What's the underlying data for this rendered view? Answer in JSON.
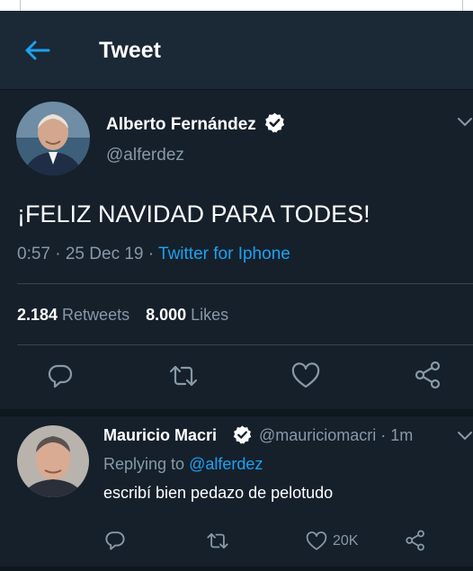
{
  "header": {
    "title": "Tweet",
    "back_icon": "back-arrow-icon",
    "accent": "#1da1f2"
  },
  "tweet": {
    "author_name": "Alberto Fernández",
    "handle": "@alferdez",
    "text": "¡FELIZ NAVIDAD PARA TODES!",
    "time": "0:57 · 25 Dec 19 · ",
    "source": "Twitter for Iphone",
    "retweets_count": "2.184",
    "retweets_label": " Retweets",
    "likes_count": "8.000",
    "likes_label": " Likes",
    "actions": [
      "reply-icon",
      "retweet-icon",
      "like-icon",
      "share-icon"
    ]
  },
  "reply": {
    "author_name": "Mauricio Macri",
    "handle_time": "@mauriciomacri · 1m",
    "replying_prefix": "Replying to ",
    "replying_mention": "@alferdez",
    "text": "escribí bien pedazo de pelotudo",
    "like_count": "20K"
  },
  "colors": {
    "background": "#15202b",
    "header": "#1b2836",
    "secondary_text": "#8899a6",
    "link": "#1da1f2"
  }
}
